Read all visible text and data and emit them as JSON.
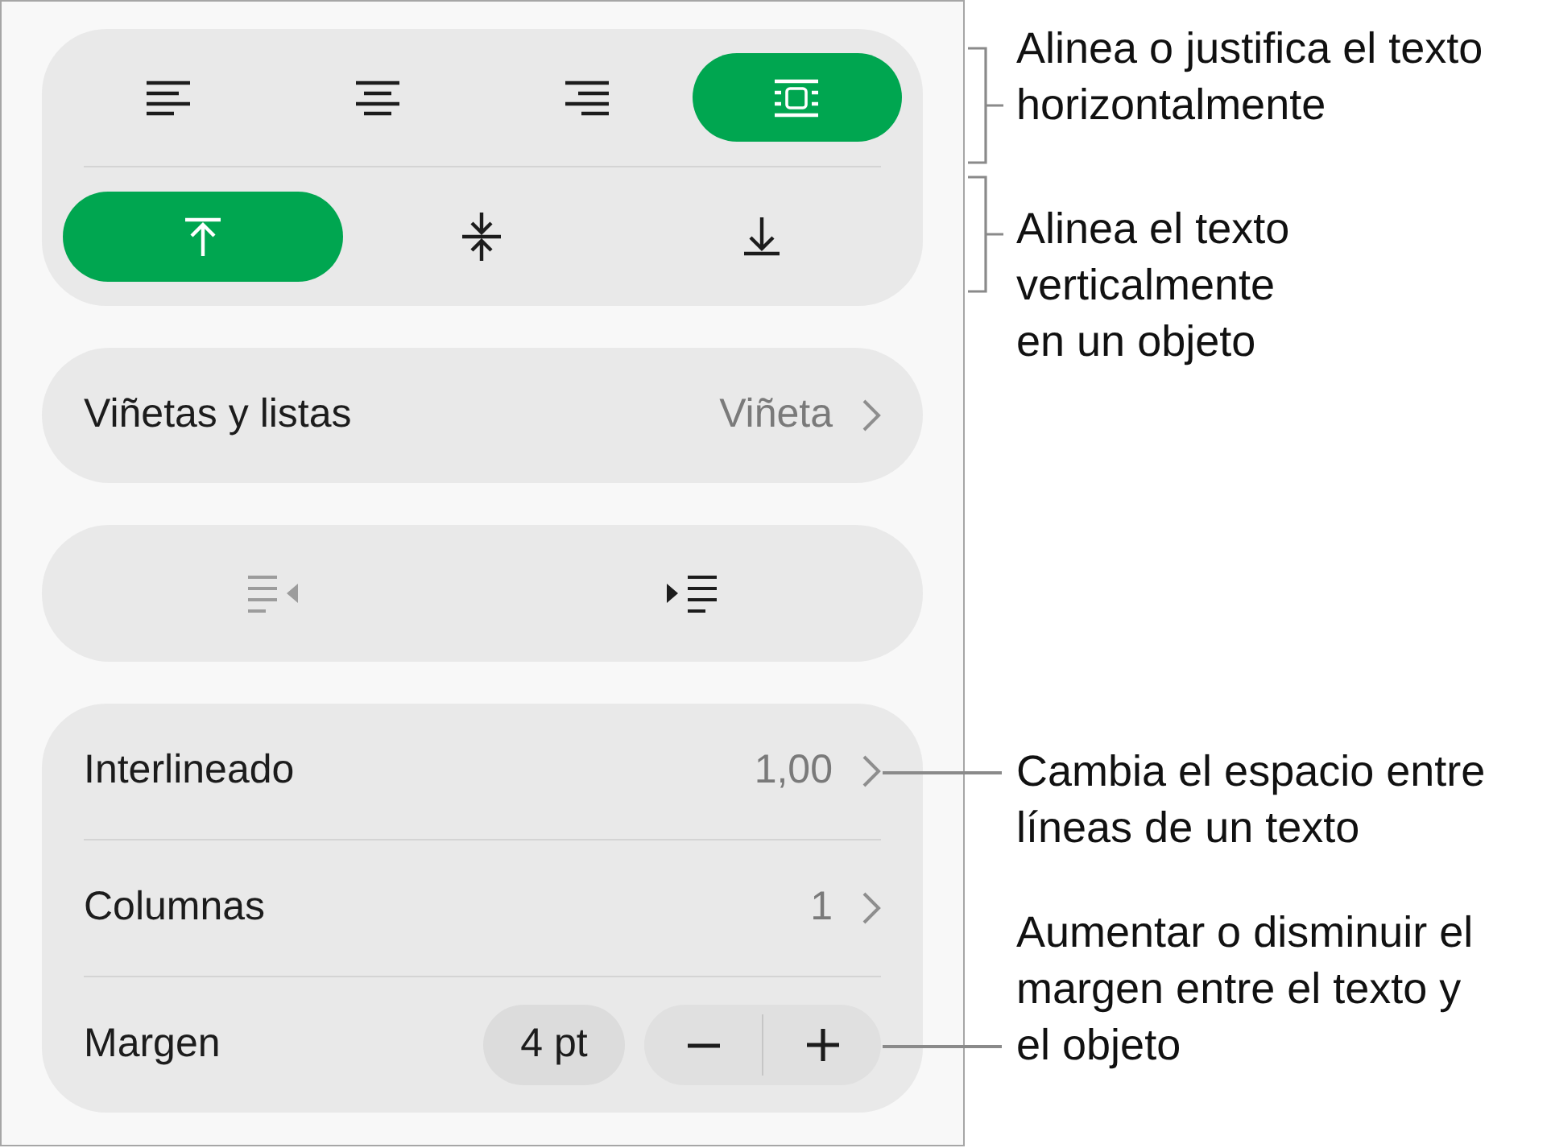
{
  "alignment": {
    "horizontal": [
      {
        "kind": "left",
        "selected": false
      },
      {
        "kind": "center",
        "selected": false
      },
      {
        "kind": "right",
        "selected": false
      },
      {
        "kind": "justify",
        "selected": true
      }
    ],
    "vertical": [
      {
        "kind": "top",
        "selected": true
      },
      {
        "kind": "middle",
        "selected": false
      },
      {
        "kind": "bottom",
        "selected": false
      }
    ]
  },
  "bullets": {
    "label": "Viñetas y listas",
    "value": "Viñeta"
  },
  "indent": [
    {
      "kind": "decrease",
      "disabled": true
    },
    {
      "kind": "increase",
      "disabled": false
    }
  ],
  "settings": [
    {
      "kind": "disclosure",
      "label": "Interlineado",
      "value": "1,00"
    },
    {
      "kind": "disclosure",
      "label": "Columnas",
      "value": "1"
    },
    {
      "kind": "stepper",
      "label": "Margen",
      "value": "4 pt"
    }
  ],
  "callouts": [
    {
      "kind": "bracket",
      "text": "Alinea o justifica el texto\nhorizontalmente"
    },
    {
      "kind": "bracket",
      "text": "Alinea el texto\nverticalmente\nen un objeto"
    },
    {
      "kind": "leader",
      "text": "Cambia el espacio entre\nlíneas de un texto"
    },
    {
      "kind": "leader",
      "text": "Aumentar o disminuir el\nmargen entre el texto y\nel objeto"
    }
  ]
}
